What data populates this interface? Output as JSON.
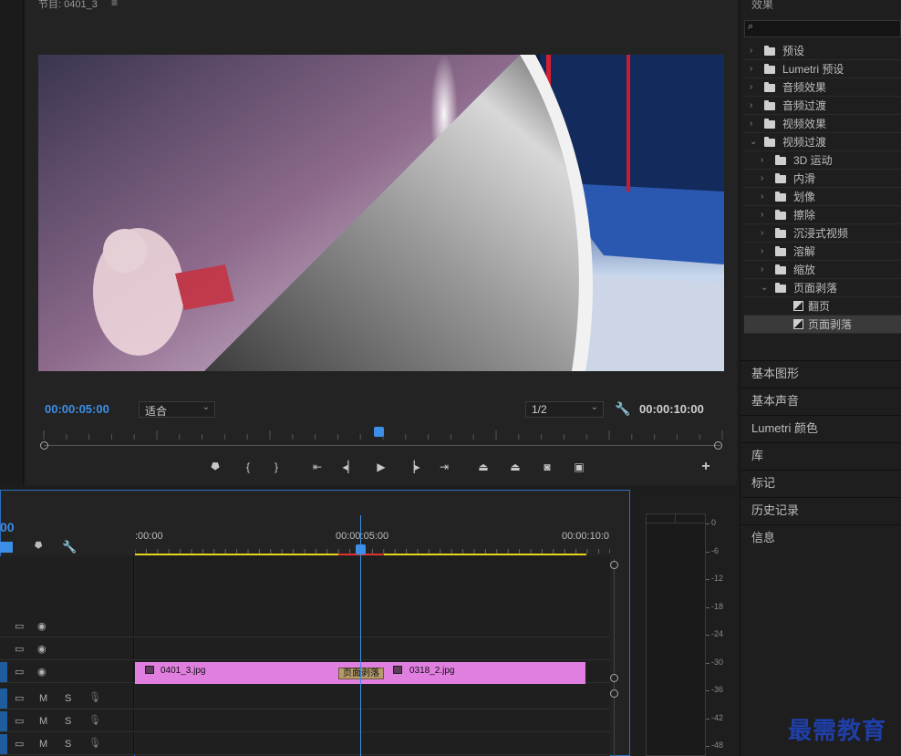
{
  "program": {
    "title": "节目: 0401_3",
    "menu_icon": "≡",
    "timecode_current": "00:00:05:00",
    "timecode_duration": "00:00:10:00",
    "fit_select": "适合",
    "resolution_select": "1/2"
  },
  "timeline": {
    "timecode_partial": "00",
    "ruler_labels": [
      ":00:00",
      "00:00:05:00",
      "00:00:10:0"
    ],
    "clips": [
      {
        "name": "0401_3.jpg"
      },
      {
        "name": "0318_2.jpg"
      }
    ],
    "transition": "页面剥落",
    "track_buttons": {
      "mute": "M",
      "solo": "S"
    }
  },
  "effects": {
    "title": "效果",
    "tree": [
      {
        "label": "预设",
        "depth": 0,
        "expanded": false,
        "kind": "preset"
      },
      {
        "label": "Lumetri 预设",
        "depth": 0,
        "expanded": false,
        "kind": "preset"
      },
      {
        "label": "音频效果",
        "depth": 0,
        "expanded": false,
        "kind": "folder"
      },
      {
        "label": "音频过渡",
        "depth": 0,
        "expanded": false,
        "kind": "folder"
      },
      {
        "label": "视频效果",
        "depth": 0,
        "expanded": false,
        "kind": "folder"
      },
      {
        "label": "视频过渡",
        "depth": 0,
        "expanded": true,
        "kind": "folder"
      },
      {
        "label": "3D 运动",
        "depth": 1,
        "expanded": false,
        "kind": "folder"
      },
      {
        "label": "内滑",
        "depth": 1,
        "expanded": false,
        "kind": "folder"
      },
      {
        "label": "划像",
        "depth": 1,
        "expanded": false,
        "kind": "folder"
      },
      {
        "label": "擦除",
        "depth": 1,
        "expanded": false,
        "kind": "folder"
      },
      {
        "label": "沉浸式视频",
        "depth": 1,
        "expanded": false,
        "kind": "folder"
      },
      {
        "label": "溶解",
        "depth": 1,
        "expanded": false,
        "kind": "folder"
      },
      {
        "label": "缩放",
        "depth": 1,
        "expanded": false,
        "kind": "folder"
      },
      {
        "label": "页面剥落",
        "depth": 1,
        "expanded": true,
        "kind": "folder"
      },
      {
        "label": "翻页",
        "depth": 2,
        "expanded": false,
        "kind": "effect"
      },
      {
        "label": "页面剥落",
        "depth": 2,
        "expanded": false,
        "kind": "effect",
        "selected": true
      }
    ]
  },
  "panels": [
    "基本图形",
    "基本声音",
    "Lumetri 颜色",
    "库",
    "标记",
    "历史记录",
    "信息"
  ],
  "meter": {
    "db_labels": [
      "0",
      "-6",
      "-12",
      "-18",
      "-24",
      "-30",
      "-36",
      "-42",
      "-48"
    ]
  },
  "watermark": "最需教育",
  "colors": {
    "accent": "#3d8ee6",
    "clip": "#e07fe0",
    "transition": "#b59a6a",
    "work_area": "#e6d41c",
    "render_bar": "#e03030"
  }
}
